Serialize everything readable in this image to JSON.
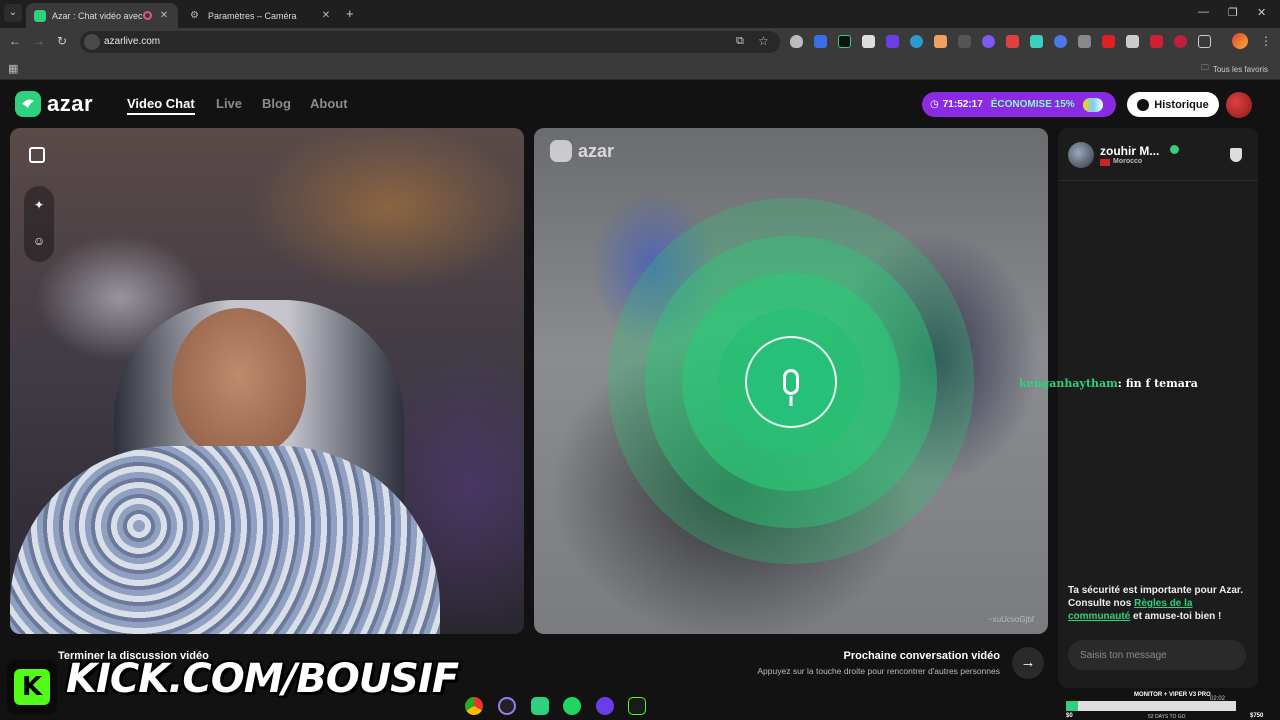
{
  "browser": {
    "tabs": [
      {
        "title": "Azar : Chat vidéo avec de n",
        "active": true
      },
      {
        "title": "Paramètres – Caméra",
        "active": false
      }
    ],
    "url": "azarlive.com",
    "bookmarks_all": "Tous les favoris"
  },
  "header": {
    "logo": "azar",
    "nav": [
      "Video Chat",
      "Live",
      "Blog",
      "About"
    ],
    "active_nav": "Video Chat",
    "promo_timer": "71:52:17",
    "promo_label": "ÉCONOMISE 15%",
    "history_label": "Historique"
  },
  "video": {
    "watermark": "azar",
    "watermark_id": "~xuUcvoGjbf"
  },
  "chat_panel": {
    "peer_name": "zouhir M...",
    "peer_country": "Morocco",
    "safety_text": "Ta sécurité est importante pour Azar. Consulte nos ",
    "safety_link": "Règles de la communauté",
    "safety_end": " et amuse-toi bien !",
    "input_placeholder": "Saisis ton message"
  },
  "stream_chat": {
    "user": "kenganhaytham",
    "message": "fin f temara"
  },
  "controls": {
    "end_call": "Terminer la discussion vidéo",
    "next_title": "Prochaine conversation vidéo",
    "next_hint": "Appuyez sur la touche droite pour rencontrer d'autres personnes",
    "next_arrow": "→"
  },
  "overlay": {
    "kick_letter": "K",
    "kick_url": "KICK.COM/BOUSIF"
  },
  "monitor_goal": {
    "label": "MONITOR + VIPER V3 PRO",
    "amount": "$44 (5.87%)",
    "progress_percent": 5.87,
    "min": "$0",
    "max": "$750",
    "days_left": "52 DAYS TO GO",
    "time": "02:02"
  },
  "colors": {
    "accent": "#2fd07e",
    "promo": "#8a2be2",
    "kick": "#53fc18"
  }
}
